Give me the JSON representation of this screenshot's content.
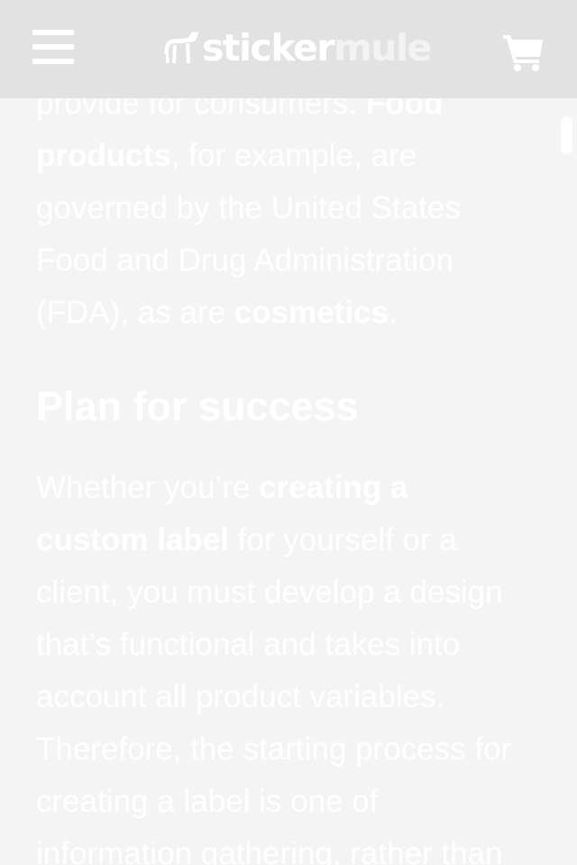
{
  "header": {
    "menu_icon": "hamburger-menu-icon",
    "logo": {
      "part1": "sticker",
      "part2": "mule",
      "icon": "mule-logo-icon"
    },
    "cart_icon": "shopping-cart-icon"
  },
  "article": {
    "para1": {
      "line1": {
        "t1": "provide for consumers. ",
        "b1": "Food"
      },
      "line2": {
        "b1": "products",
        "t1": ", for example, are"
      },
      "line3": "governed by the United States",
      "line4": "Food and Drug Administration",
      "line5": {
        "t1": "(FDA), as are ",
        "b1": "cosmetics",
        "t2": "."
      }
    },
    "heading": "Plan for success",
    "para2": {
      "line1": {
        "t1": "Whether you’re ",
        "b1": "creating a"
      },
      "line2": {
        "b1": "custom label",
        "t1": " for yourself or a"
      },
      "line3": "client, you must develop a design",
      "line4": "that’s functional and takes into",
      "line5": "account all product variables.",
      "line6": "Therefore, the starting process for",
      "line7": "creating a label is one of",
      "line8": "information gathering, rather than"
    }
  },
  "colors": {
    "header_bg": "#e2e2e2",
    "page_bg": "#f4f4f4",
    "text": "#ffffff"
  }
}
